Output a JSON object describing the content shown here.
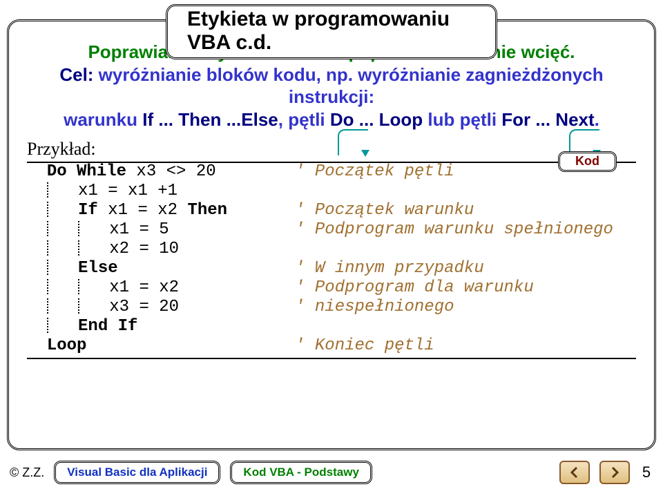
{
  "title": "Etykieta w programowaniu VBA c.d.",
  "intro": {
    "line1": "Poprawianie czytelności kodu poprzez wstawianie wcięć.",
    "line2_pre": "Cel: ",
    "line2_body": "wyróżnianie bloków kodu, np. wyróżnianie zagnieżdżonych instrukcji:",
    "line3_parts": {
      "warunku": "warunku ",
      "if": "If ... Then ...Else",
      "petli": ", pętli ",
      "do": "Do ... Loop",
      "lub": " lub pętli ",
      "for": "For ... Next",
      "dot": "."
    }
  },
  "example_label": "Przykład:",
  "kod_badge": "Kod",
  "code": [
    {
      "c": "Do While x3 <> 20",
      "kw": "Do While",
      "ind": 0,
      "com": "' Początek pętli"
    },
    {
      "c": "x1 = x1 +1",
      "ind": 1,
      "com": ""
    },
    {
      "c": "If x1 = x2 Then",
      "kw": "If|Then",
      "ind": 1,
      "com": "' Początek warunku"
    },
    {
      "c": "x1 = 5",
      "ind": 2,
      "com": "' Podprogram warunku spełnionego"
    },
    {
      "c": "x2 = 10",
      "ind": 2,
      "com": ""
    },
    {
      "c": "Else",
      "kw": "Else",
      "ind": 1,
      "com": "' W innym przypadku"
    },
    {
      "c": "x1 = x2",
      "ind": 2,
      "com": "' Podprogram dla warunku"
    },
    {
      "c": "x3 = 20",
      "ind": 2,
      "com": "' niespełnionego"
    },
    {
      "c": "End If",
      "kw": "End If",
      "ind": 1,
      "com": ""
    },
    {
      "c": "Loop",
      "kw": "Loop",
      "ind": 0,
      "com": "' Koniec pętli"
    }
  ],
  "footer": {
    "copyright": "© Z.Z.",
    "pill_left": "Visual Basic dla Aplikacji",
    "pill_right": "Kod VBA - Podstawy",
    "page": "5"
  }
}
